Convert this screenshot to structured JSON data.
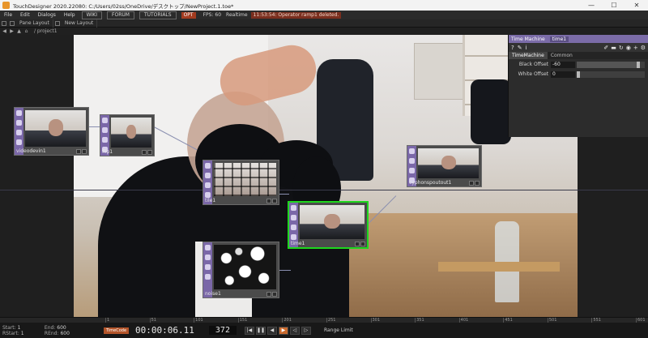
{
  "window": {
    "title": "TouchDesigner 2020.22080: C:/Users/02ss/OneDrive/デスクトップ/NewProject.1.toe*",
    "minimize": "—",
    "maximize": "☐",
    "close": "✕"
  },
  "menu": {
    "file": "File",
    "edit": "Edit",
    "dialogs": "Dialogs",
    "help": "Help",
    "wiki": "WIKI",
    "forum": "FORUM",
    "tutorials": "TUTORIALS",
    "opt_badge": "OPT",
    "fps": "FPS: 60",
    "realtime": "Realtime",
    "status_error": "11:53:54: Operator ramp1 deleted."
  },
  "panebar": {
    "pane_layout": "Pane Layout",
    "new_layout": "New Layout"
  },
  "path": "/ project1",
  "nodes": {
    "videodevin": "videodevin1",
    "flip": "flip1",
    "tile": "tile1",
    "time": "time1",
    "noise": "noise1",
    "cache": "cyphonspoutout1"
  },
  "params": {
    "op_type": "Time Machine",
    "op_name": "time1",
    "tabs": [
      "TimeMachine",
      "Common"
    ],
    "rows": [
      {
        "label": "Black Offset",
        "value": "-60",
        "level": 0.93
      },
      {
        "label": "White Offset",
        "value": "0",
        "level": 0.0
      }
    ]
  },
  "timeline": {
    "start_label": "Start:",
    "start": "1",
    "end_label": "End:",
    "end": "600",
    "rstart_label": "RStart:",
    "rstart": "1",
    "rend_label": "REnd:",
    "rend": "600",
    "timecode_button": "TimeCode",
    "timecode": "00:00:06.11",
    "frame": "372",
    "range_limit": "Range Limit",
    "ticks": [
      "1",
      "51",
      "101",
      "151",
      "201",
      "251",
      "301",
      "351",
      "401",
      "451",
      "501",
      "551",
      "601"
    ]
  },
  "colors": {
    "operator_purple": "#7a67a8",
    "selection_green": "#1ed61e",
    "play_orange": "#c96a2e"
  }
}
